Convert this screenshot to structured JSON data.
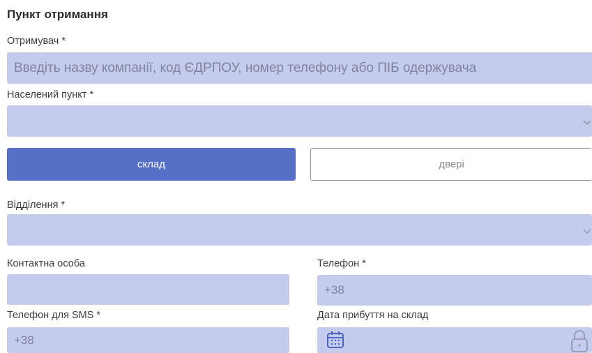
{
  "section": {
    "title": "Пункт отримання"
  },
  "recipient": {
    "label": "Отримувач *",
    "placeholder": "Введіть назву компанії, код ЄДРПОУ, номер телефону або ПІБ одержувача"
  },
  "city": {
    "label": "Населений пункт *",
    "value": ""
  },
  "delivery_type": {
    "warehouse_label": "склад",
    "door_label": "двері",
    "selected": "склад"
  },
  "branch": {
    "label": "Відділення *",
    "value": ""
  },
  "contact": {
    "label": "Контактна особа",
    "value": ""
  },
  "phone": {
    "label": "Телефон *",
    "value": "+38"
  },
  "sms_phone": {
    "label": "Телефон для SMS *",
    "value": "+38"
  },
  "arrival_date": {
    "label": "Дата прибуття на склад",
    "value": ""
  },
  "icons": {
    "chevron": "chevron-down-icon",
    "calendar": "calendar-icon",
    "lock": "lock-icon"
  },
  "colors": {
    "field_bg": "#c4cbec",
    "primary": "#5670c8",
    "outline_border": "#8a8ea3"
  }
}
